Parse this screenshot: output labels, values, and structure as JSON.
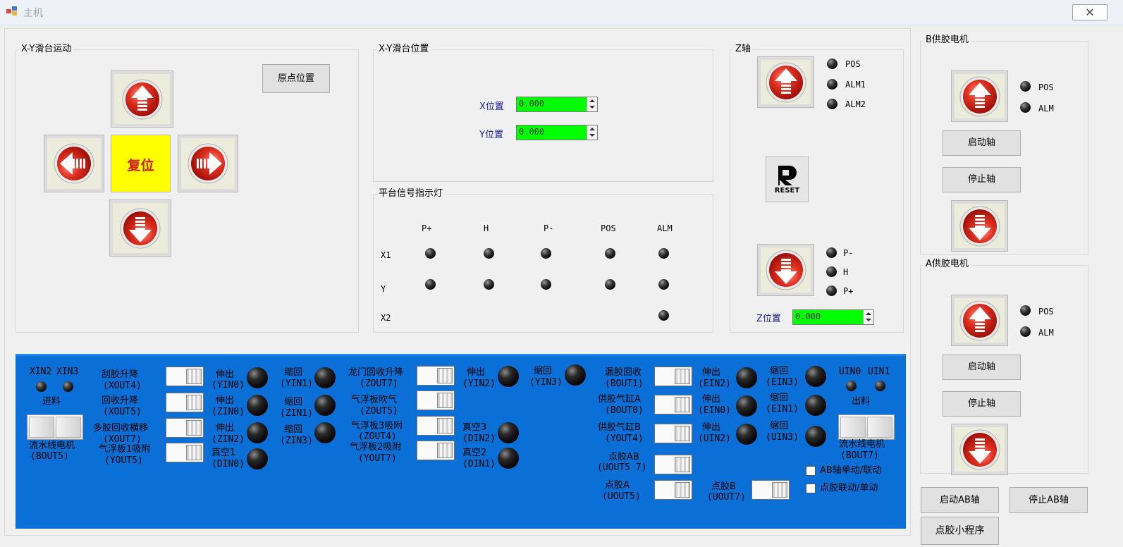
{
  "window": {
    "title": "主机",
    "close_glyph": "✕"
  },
  "xy_motion": {
    "title": "X-Y滑台运动",
    "home_button": "原点位置",
    "reset_label": "复位",
    "reset_color": "#ffff00"
  },
  "xy_position": {
    "title": "X-Y滑台位置",
    "x_label": "X位置",
    "x_value": "0.000",
    "y_label": "Y位置",
    "y_value": "0.000"
  },
  "signals": {
    "title": "平台信号指示灯",
    "columns": [
      "P+",
      "H",
      "P-",
      "POS",
      "ALM"
    ],
    "rows": [
      "X1",
      "Y",
      "X2"
    ]
  },
  "z_axis": {
    "title": "Z轴",
    "top_leds": [
      "POS",
      "ALM1",
      "ALM2"
    ],
    "bottom_leds": [
      "P-",
      "H",
      "P+"
    ],
    "reset_text": "RESET",
    "position_label": "Z位置",
    "position_value": "0.000"
  },
  "b_motor": {
    "title": "B供胶电机",
    "leds": [
      "POS",
      "ALM"
    ],
    "start": "启动轴",
    "stop": "停止轴"
  },
  "a_motor": {
    "title": "A供胶电机",
    "leds": [
      "POS",
      "ALM"
    ],
    "start": "启动轴",
    "stop": "停止轴"
  },
  "bottom_buttons": {
    "start_ab": "启动AB轴",
    "stop_ab": "停止AB轴",
    "dispense_app": "点胶小程序"
  },
  "io_panel": {
    "xin2": "XIN2",
    "xin3": "XIN3",
    "feed_in": "进料",
    "conveyor_left": "流水线电机",
    "conveyor_left_code": "(BOUT5)",
    "uin0": "UIN0",
    "uin1": "UIN1",
    "feed_out": "出料",
    "conveyor_right": "流水线电机",
    "conveyor_right_code": "(BOUT7)",
    "c1": [
      {
        "name": "刮胶升降",
        "code": "(XOUT4)"
      },
      {
        "name": "回收升降",
        "code": "(XOUT5)"
      },
      {
        "name": "多胶回收横移",
        "code": "(XOUT7)"
      },
      {
        "name": "气浮板1吸附",
        "code": "(YOUT5)"
      }
    ],
    "c1_ext": [
      {
        "name": "伸出",
        "code": "(YIN0)"
      },
      {
        "name": "伸出",
        "code": "(ZIN0)"
      },
      {
        "name": "伸出",
        "code": "(ZIN2)"
      },
      {
        "name": "真空1",
        "code": "(DIN0)"
      }
    ],
    "c1_ret": [
      {
        "name": "缩回",
        "code": "(YIN1)"
      },
      {
        "name": "缩回",
        "code": "(ZIN1)"
      },
      {
        "name": "缩回",
        "code": "(ZIN3)"
      }
    ],
    "c2": [
      {
        "name": "龙门回收升降",
        "code": "(ZOUT7)"
      },
      {
        "name": "气浮板吹气",
        "code": "(ZOUT5)"
      },
      {
        "name": "气浮板3吸附",
        "code": "(ZOUT4)"
      },
      {
        "name": "气浮板2吸附",
        "code": "(YOUT7)"
      }
    ],
    "c2_ext": {
      "name": "伸出",
      "code": "(YIN2)"
    },
    "c2_ret": {
      "name": "缩回",
      "code": "(YIN3)"
    },
    "vac3": {
      "name": "真空3",
      "code": "(DIN2)"
    },
    "vac2": {
      "name": "真空2",
      "code": "(DIN1)"
    },
    "c3": [
      {
        "name": "漏胶回收",
        "code": "(BOUT1)"
      },
      {
        "name": "供胶气缸A",
        "code": "(BOUT0)"
      },
      {
        "name": "供胶气缸B",
        "code": "(YOUT4)"
      },
      {
        "name": "点胶AB",
        "code": "(UOUT5 7)"
      },
      {
        "name": "点胶A",
        "code": "(UOUT5)"
      }
    ],
    "c3_ext": [
      {
        "name": "伸出",
        "code": "(EIN2)"
      },
      {
        "name": "伸出",
        "code": "(EIN0)"
      },
      {
        "name": "伸出",
        "code": "(UIN2)"
      }
    ],
    "c3_ret": [
      {
        "name": "缩回",
        "code": "(EIN3)"
      },
      {
        "name": "缩回",
        "code": "(EIN1)"
      },
      {
        "name": "缩回",
        "code": "(UIN3)"
      }
    ],
    "dispense_b": {
      "name": "点胶B",
      "code": "(UOUT7)"
    },
    "check_ab": "AB轴单动/联动",
    "check_link": "点胶联动/单动",
    "panel_color": "#0a6fd6"
  }
}
